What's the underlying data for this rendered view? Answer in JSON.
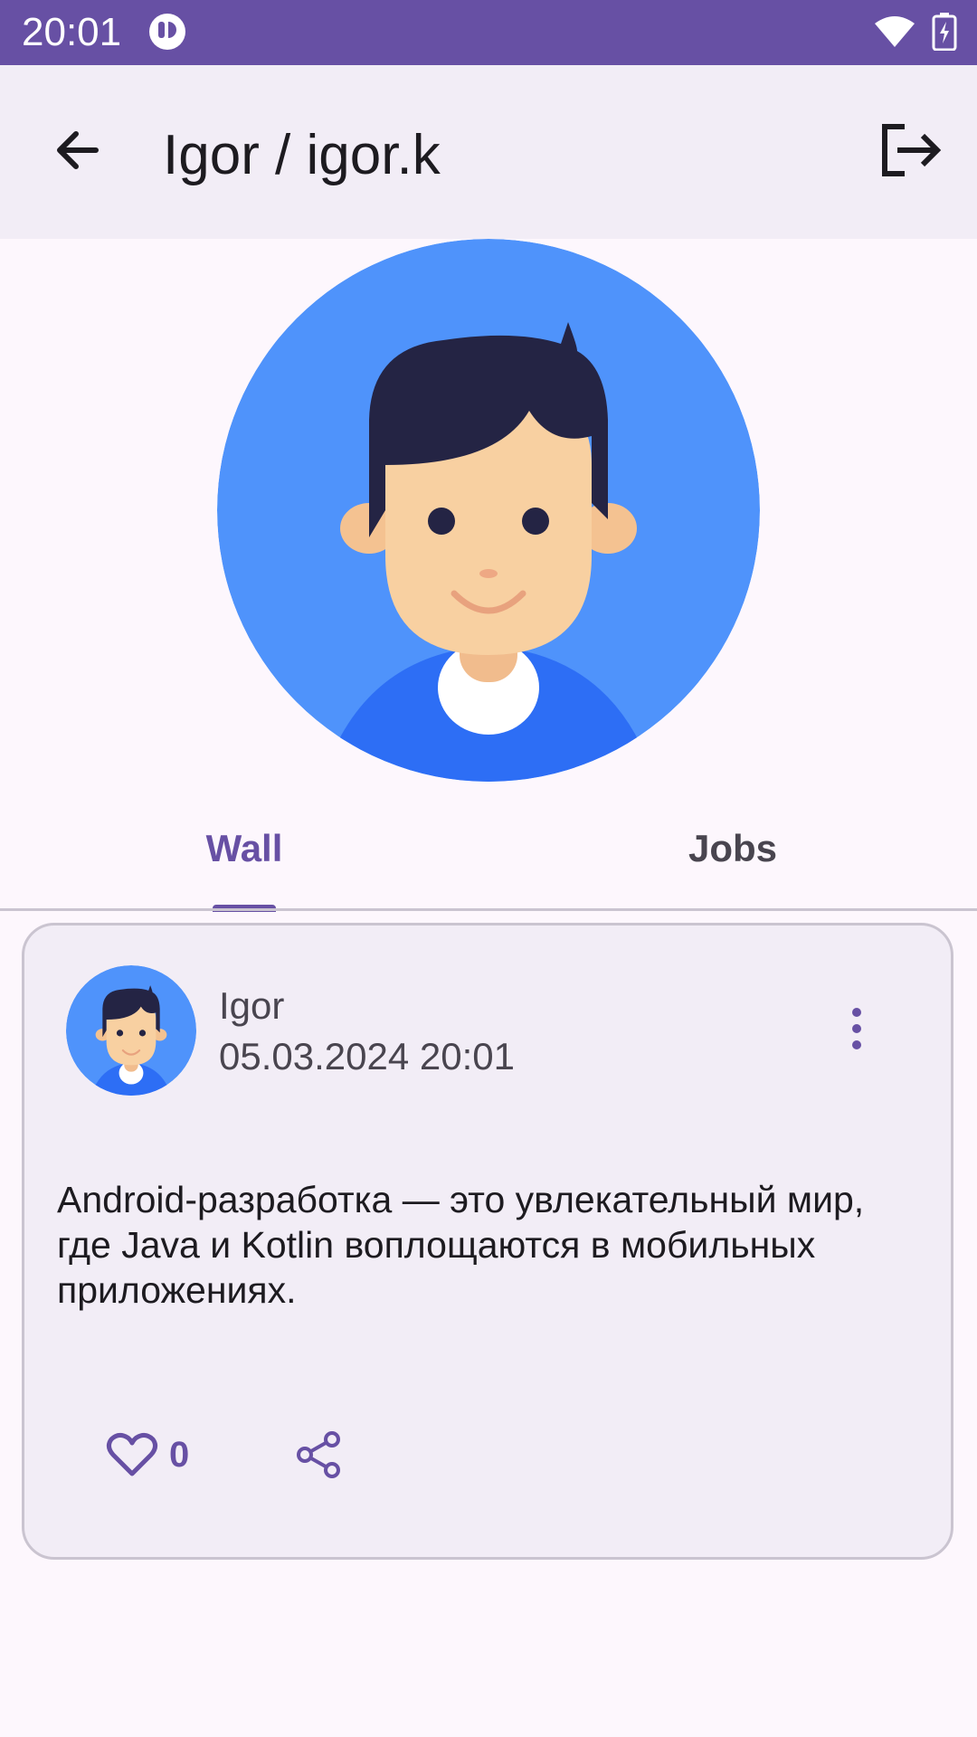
{
  "status_bar": {
    "time": "20:01",
    "icons": [
      "app-notification-icon",
      "wifi-icon",
      "battery-charging-icon"
    ]
  },
  "app_bar": {
    "title": "Igor / igor.k",
    "back_icon": "arrow-back-icon",
    "logout_icon": "logout-icon"
  },
  "profile": {
    "avatar_icon": "user-avatar"
  },
  "tabs": [
    {
      "label": "Wall",
      "selected": true
    },
    {
      "label": "Jobs",
      "selected": false
    }
  ],
  "post": {
    "author": "Igor",
    "date": "05.03.2024 20:01",
    "text": "Android-разработка — это увлекательный мир, где Java и Kotlin воплощаются в мобильных приложениях.",
    "likes": "0",
    "menu_icon": "more-vert-icon",
    "like_icon": "heart-outline-icon",
    "share_icon": "share-icon"
  },
  "colors": {
    "primary": "#6750a4",
    "avatar_bg": "#4f93fb",
    "surface": "#fdf7fd",
    "card": "#f2edf6"
  }
}
